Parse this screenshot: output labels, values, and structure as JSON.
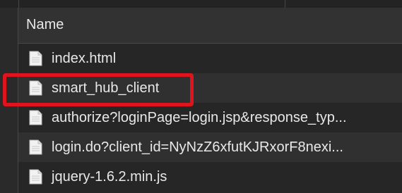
{
  "header": {
    "column_name": "Name"
  },
  "rows": [
    {
      "label": "index.html",
      "icon": "document-icon"
    },
    {
      "label": "smart_hub_client",
      "icon": "document-icon"
    },
    {
      "label": "authorize?loginPage=login.jsp&response_typ...",
      "icon": "document-icon"
    },
    {
      "label": "login.do?client_id=NyNzZ6xfutKJRxorF8nexi...",
      "icon": "document-icon"
    },
    {
      "label": "jquery-1.6.2.min.js",
      "icon": "document-icon"
    }
  ],
  "colors": {
    "highlight": "#e0141c",
    "background": "#262626",
    "row_alt": "#303030",
    "text": "#e8e8e8"
  }
}
